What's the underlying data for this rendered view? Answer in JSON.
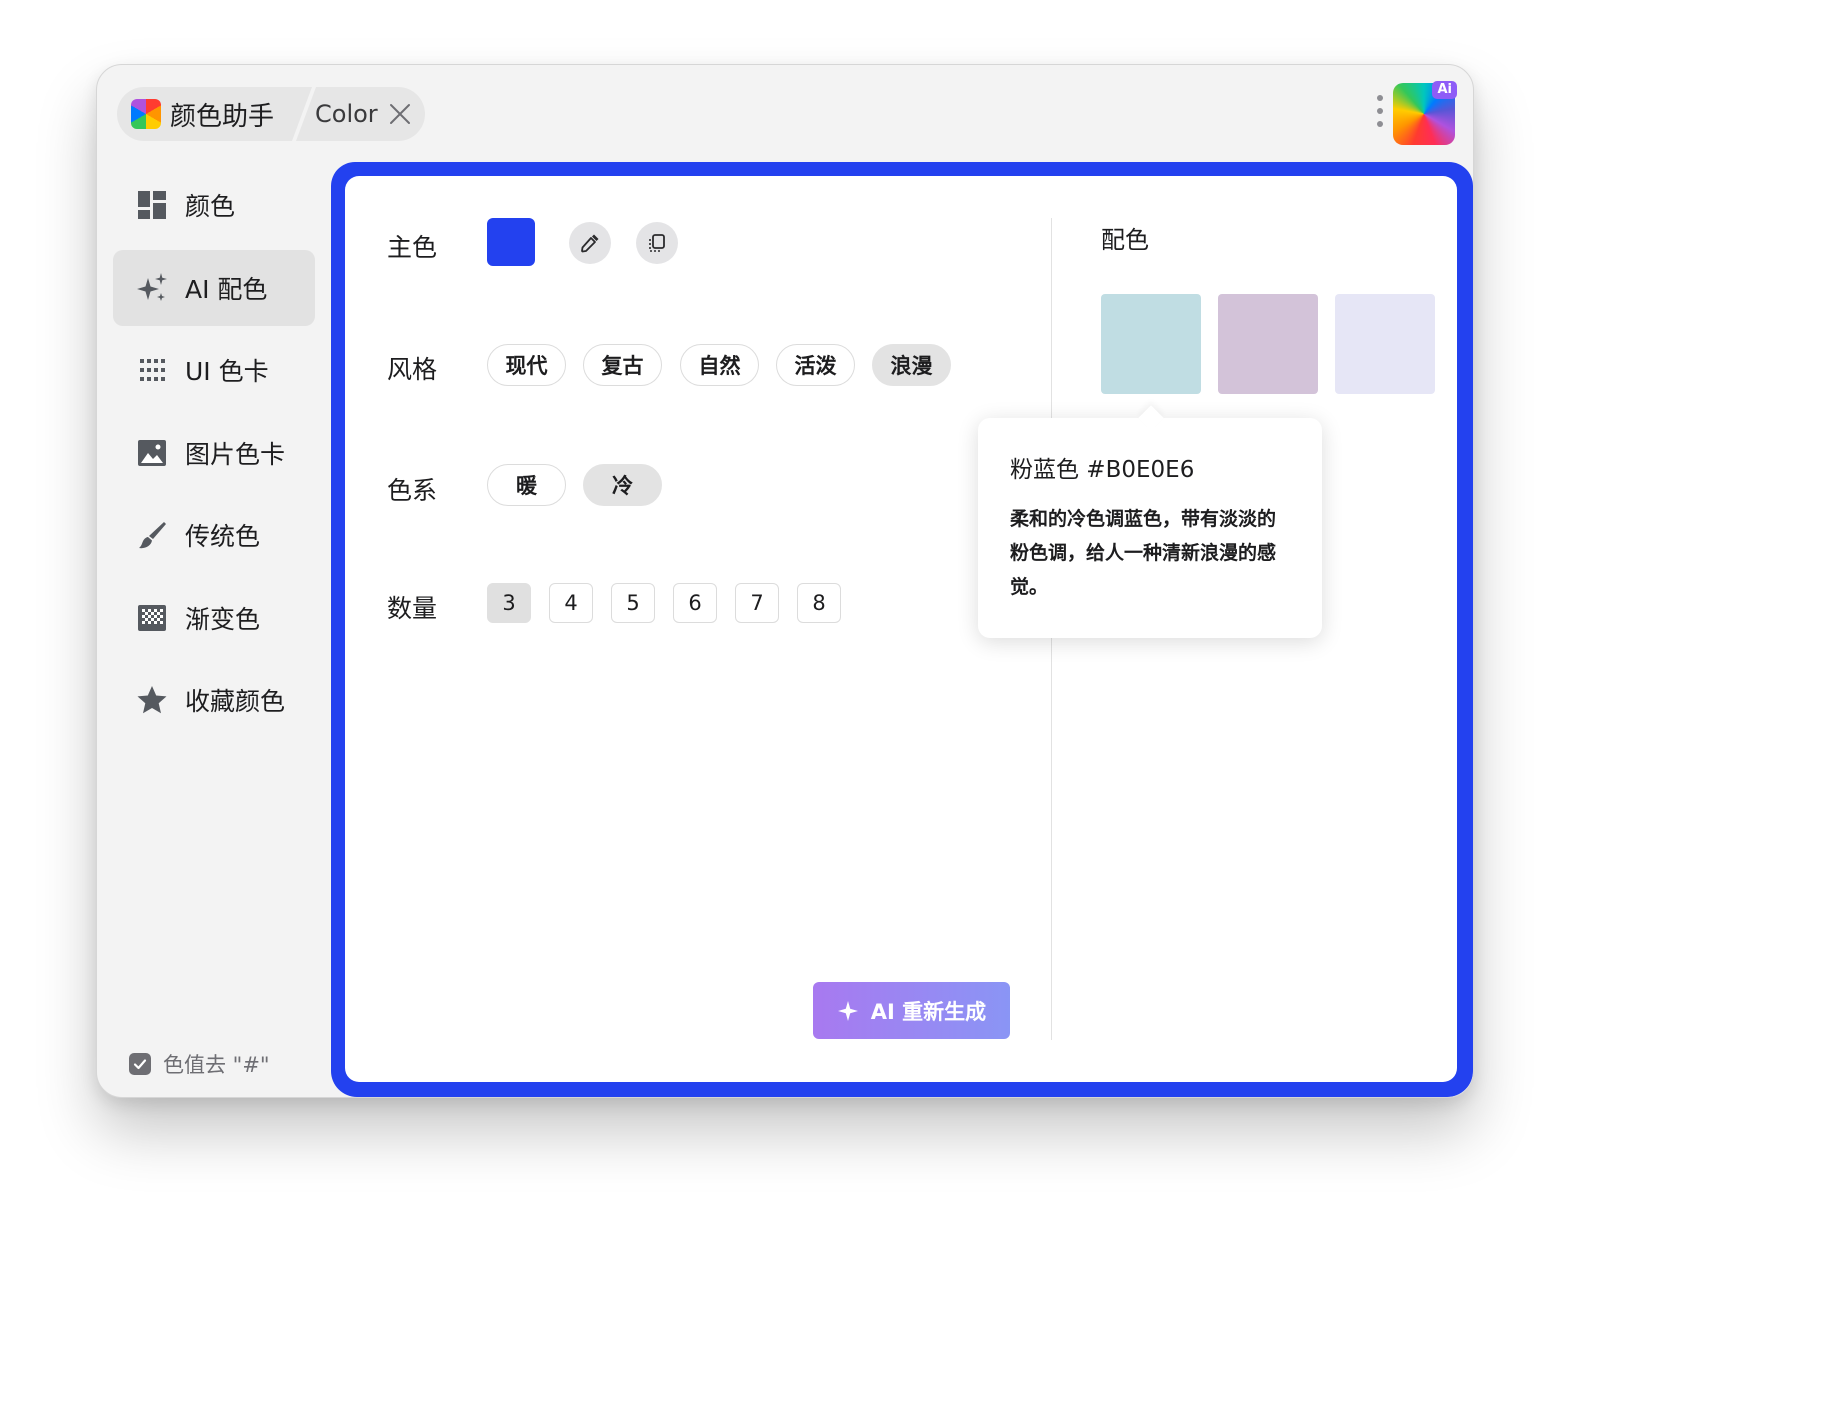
{
  "titlebar": {
    "app_title": "颜色助手",
    "second_tab": "Color",
    "ai_badge": "Ai"
  },
  "sidebar": {
    "items": [
      {
        "label": "颜色",
        "icon": "dashboard-icon"
      },
      {
        "label": "AI 配色",
        "icon": "sparkles-icon"
      },
      {
        "label": "UI 色卡",
        "icon": "dot-grid-icon"
      },
      {
        "label": "图片色卡",
        "icon": "image-icon"
      },
      {
        "label": "传统色",
        "icon": "brush-icon"
      },
      {
        "label": "渐变色",
        "icon": "gradient-icon"
      },
      {
        "label": "收藏颜色",
        "icon": "star-icon"
      }
    ],
    "active_index": 1,
    "strip_hash": {
      "label": "色值去 \"#\"",
      "checked": true
    }
  },
  "form": {
    "main_color": {
      "label": "主色",
      "value": "#2341EF"
    },
    "style": {
      "label": "风格",
      "options": [
        "现代",
        "复古",
        "自然",
        "活泼",
        "浪漫"
      ],
      "selected": "浪漫"
    },
    "tone": {
      "label": "色系",
      "options": [
        "暖",
        "冷"
      ],
      "selected": "冷"
    },
    "count": {
      "label": "数量",
      "options": [
        "3",
        "4",
        "5",
        "6",
        "7",
        "8"
      ],
      "selected": "3"
    },
    "regenerate_label": "AI 重新生成"
  },
  "palette": {
    "title": "配色",
    "colors": [
      "#C0DDE3",
      "#D3C3D9",
      "#E6E6F6"
    ]
  },
  "tooltip": {
    "title": "粉蓝色 #B0E0E6",
    "description": "柔和的冷色调蓝色，带有淡淡的粉色调，给人一种清新浪漫的感觉。"
  },
  "colors": {
    "accent": "#2341EF",
    "sidebar_bg": "#F3F3F3",
    "regen_gradient_start": "#A879F0",
    "regen_gradient_end": "#8A95F5"
  }
}
